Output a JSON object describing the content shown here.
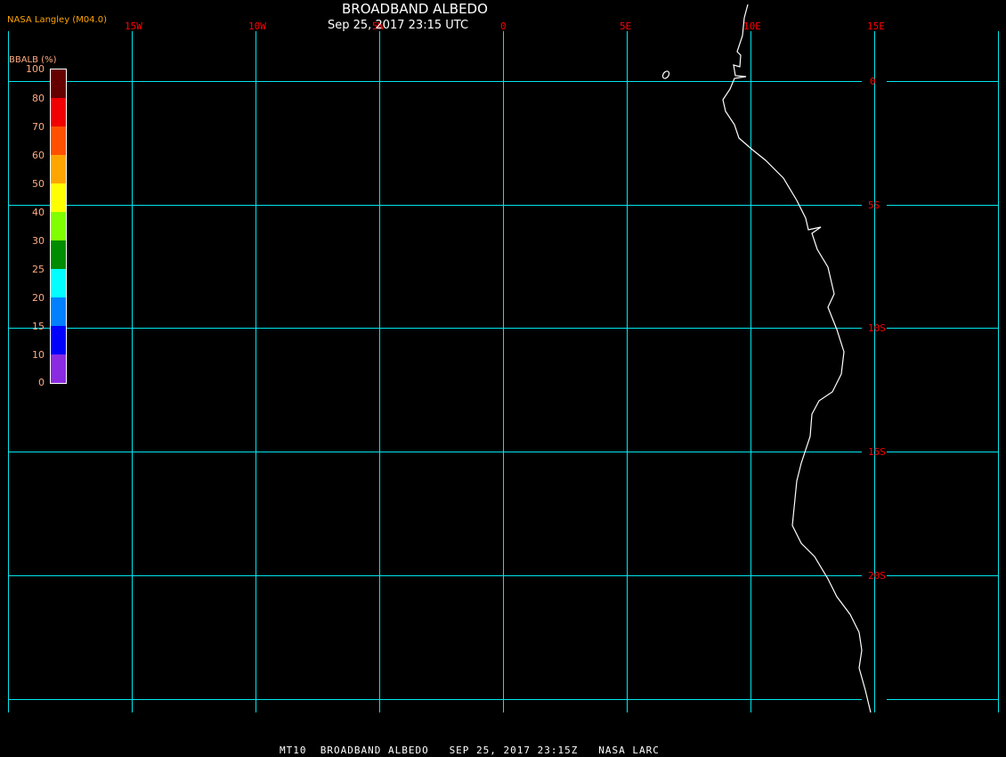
{
  "header": {
    "title": "BROADBAND ALBEDO",
    "subtitle": "Sep 25, 2017 23:15 UTC",
    "credit": "NASA Langley (M04.0)"
  },
  "footer": "MT10  BROADBAND ALBEDO   SEP 25, 2017 23:15Z   NASA LARC",
  "legend": {
    "title": "BBALB (%)",
    "labels": [
      "100",
      "80",
      "70",
      "60",
      "50",
      "40",
      "30",
      "25",
      "20",
      "15",
      "10",
      "0"
    ],
    "colors": [
      "#640000",
      "#f00000",
      "#ff5000",
      "#ffa500",
      "#ffff00",
      "#80ff00",
      "#008c00",
      "#00ffff",
      "#0080ff",
      "#0000ff",
      "#8a2be2"
    ]
  },
  "map": {
    "grid_color": "#00e5ee",
    "label_color": "#ff0000",
    "coast_color": "#ffffff",
    "lon_labels": [
      "15W",
      "10W",
      "5W",
      "0",
      "5E",
      "10E",
      "15E"
    ],
    "lat_labels": [
      "0",
      "5S",
      "10S",
      "15S",
      "20S"
    ]
  }
}
